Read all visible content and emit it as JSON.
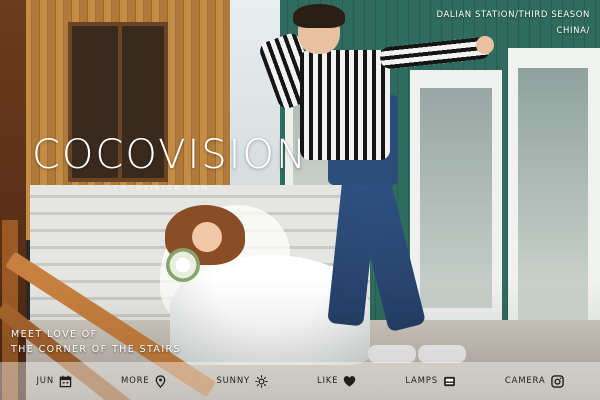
{
  "brand": {
    "name": "COCOVISION",
    "sub": "COCOVISION.COM"
  },
  "location": {
    "line1": "DALIAN STATION/THIRD SEASON",
    "line2": "CHINA/"
  },
  "caption": {
    "line1": "MEET LOVE OF",
    "line2": "THE CORNER OF THE STAIRS"
  },
  "nav": {
    "items": [
      {
        "label": "JUN",
        "icon": "calendar-icon"
      },
      {
        "label": "MORE",
        "icon": "location-pin-icon"
      },
      {
        "label": "SUNNY",
        "icon": "sun-icon"
      },
      {
        "label": "LIKE",
        "icon": "heart-icon"
      },
      {
        "label": "LAMPS",
        "icon": "lamp-icon"
      },
      {
        "label": "CAMERA",
        "icon": "camera-icon"
      }
    ]
  },
  "colors": {
    "text_light": "#ffffff",
    "nav_text": "#1e1e1e",
    "nav_bar": "rgba(255,255,255,0.42)"
  }
}
